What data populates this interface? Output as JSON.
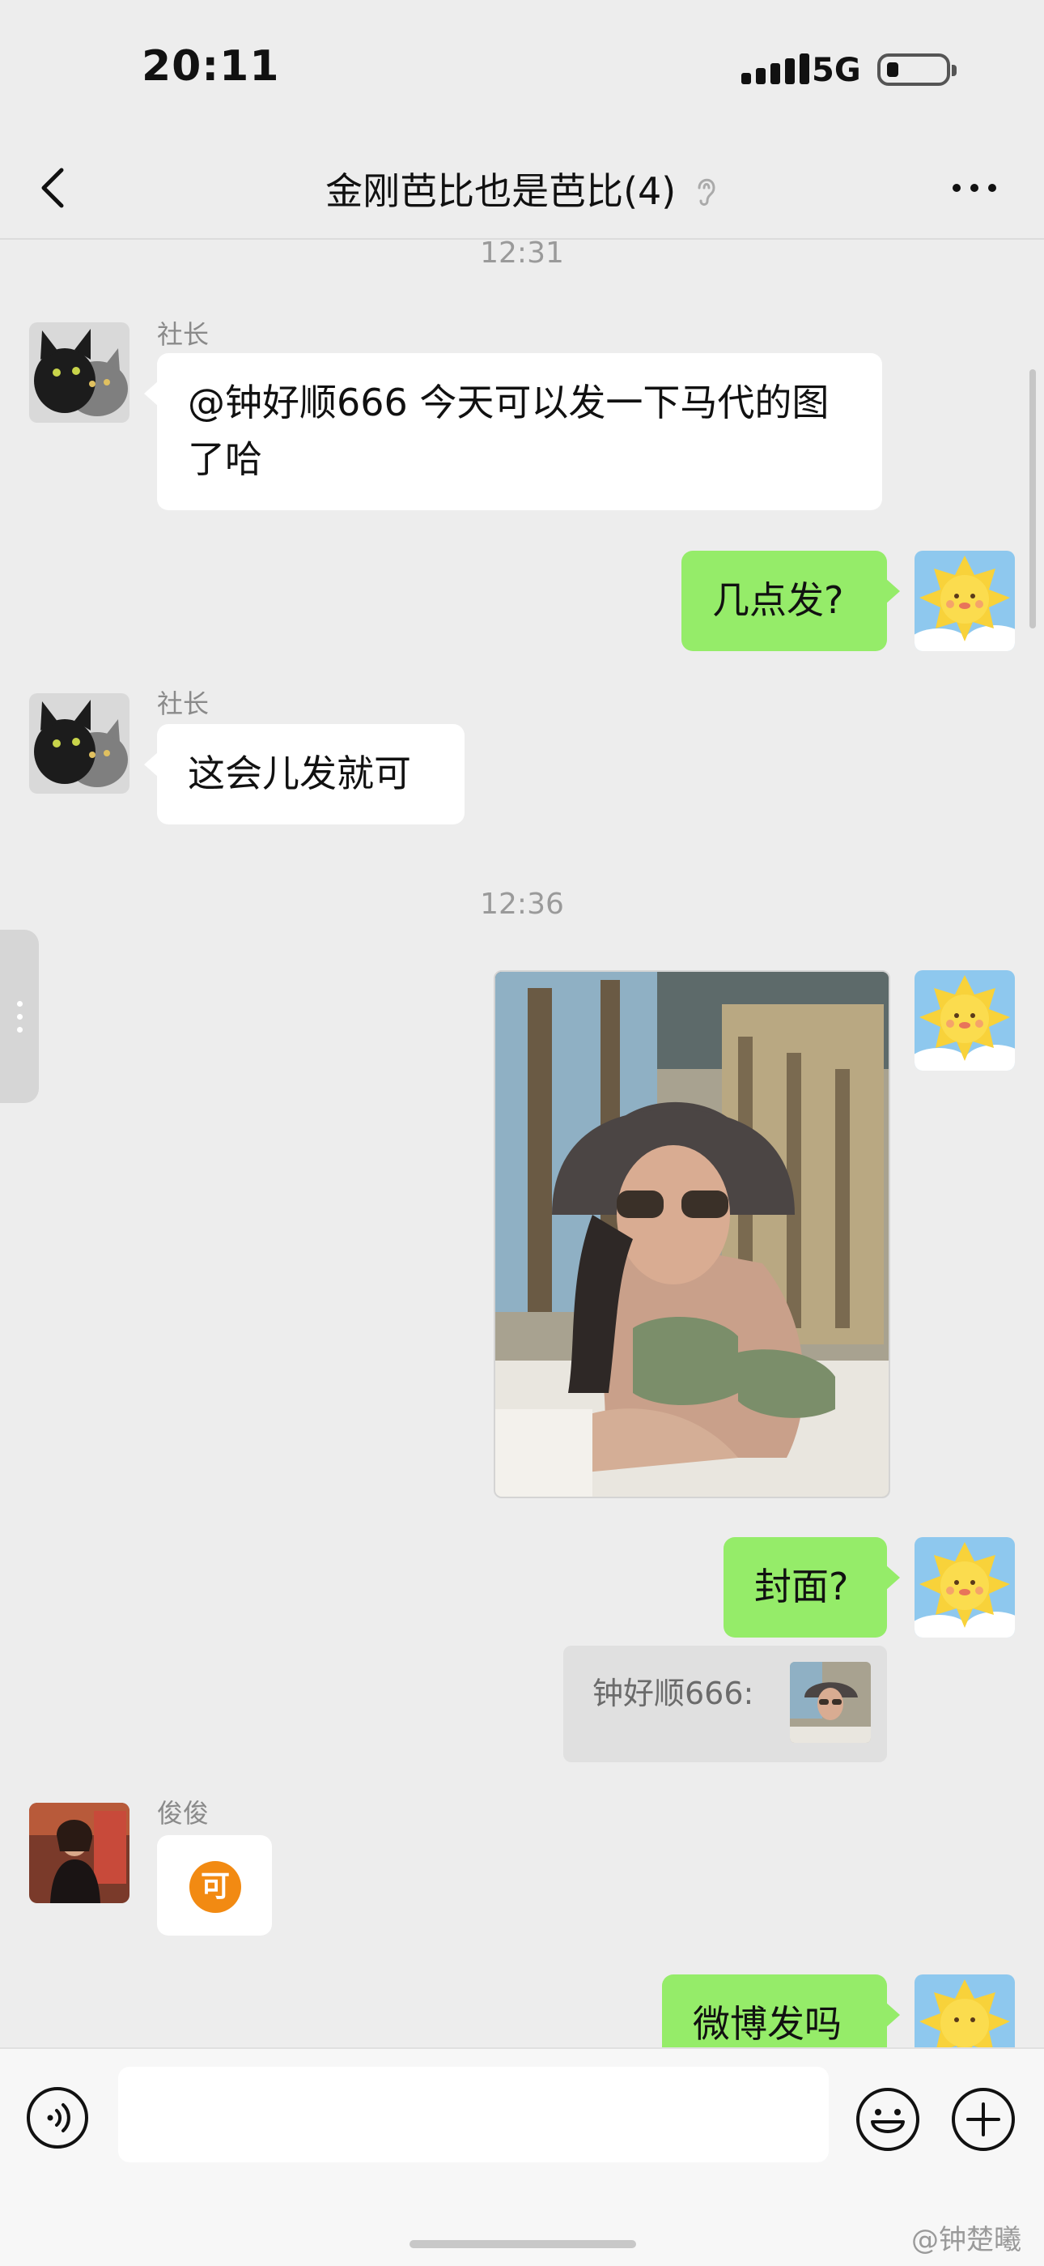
{
  "status": {
    "time": "20:11",
    "network": "5G"
  },
  "header": {
    "title": "金刚芭比也是芭比(4)",
    "back_icon": "back-chevron-icon",
    "more_icon": "more-dots-icon"
  },
  "messages": {
    "t1": "12:31",
    "m1": {
      "sender": "社长",
      "text": "@钟好顺666 今天可以发一下马代的图了哈"
    },
    "m2": {
      "text": "几点发?"
    },
    "m3": {
      "sender": "社长",
      "text": "这会儿发就可"
    },
    "t2": "12:36",
    "m5": {
      "text": "封面?"
    },
    "quote": {
      "text": "钟好顺666:"
    },
    "m6": {
      "sender": "俊俊",
      "sticker": "可"
    },
    "m7": {
      "text": "微博发吗"
    }
  },
  "input": {
    "placeholder": ""
  },
  "watermark": "@钟楚曦",
  "colors": {
    "outgoing_bubble": "#95ec69",
    "incoming_bubble": "#ffffff",
    "background": "#ededed"
  }
}
